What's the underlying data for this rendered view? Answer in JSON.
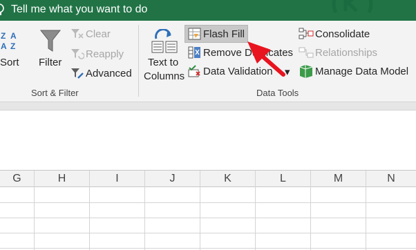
{
  "titlebar": {
    "tell_me": "Tell me what you want to do",
    "bg_color": "#217346"
  },
  "sort_filter_group": {
    "sort_label": "Sort",
    "filter_label": "Filter",
    "clear_label": "Clear",
    "reapply_label": "Reapply",
    "advanced_label": "Advanced",
    "group_label": "Sort & Filter",
    "icons": [
      "sort-az-icon",
      "filter-funnel-icon",
      "clear-filter-icon",
      "reapply-filter-icon",
      "advanced-filter-icon"
    ]
  },
  "data_tools_group": {
    "text_to_columns_line1": "Text to",
    "text_to_columns_line2": "Columns",
    "flash_fill_label": "Flash Fill",
    "remove_duplicates_label": "Remove Duplicates",
    "data_validation_label": "Data Validation",
    "data_validation_caret": "▾",
    "consolidate_label": "Consolidate",
    "relationships_label": "Relationships",
    "manage_data_model_label": "Manage Data Model",
    "group_label": "Data Tools",
    "icons": [
      "text-to-columns-icon",
      "flash-fill-icon",
      "remove-duplicates-icon",
      "data-validation-icon",
      "consolidate-icon",
      "relationships-icon",
      "manage-data-model-icon"
    ]
  },
  "grid": {
    "columns": [
      "G",
      "H",
      "I",
      "J",
      "K",
      "L",
      "M",
      "N"
    ]
  },
  "annotation": {
    "arrow_color": "#e8141f"
  }
}
